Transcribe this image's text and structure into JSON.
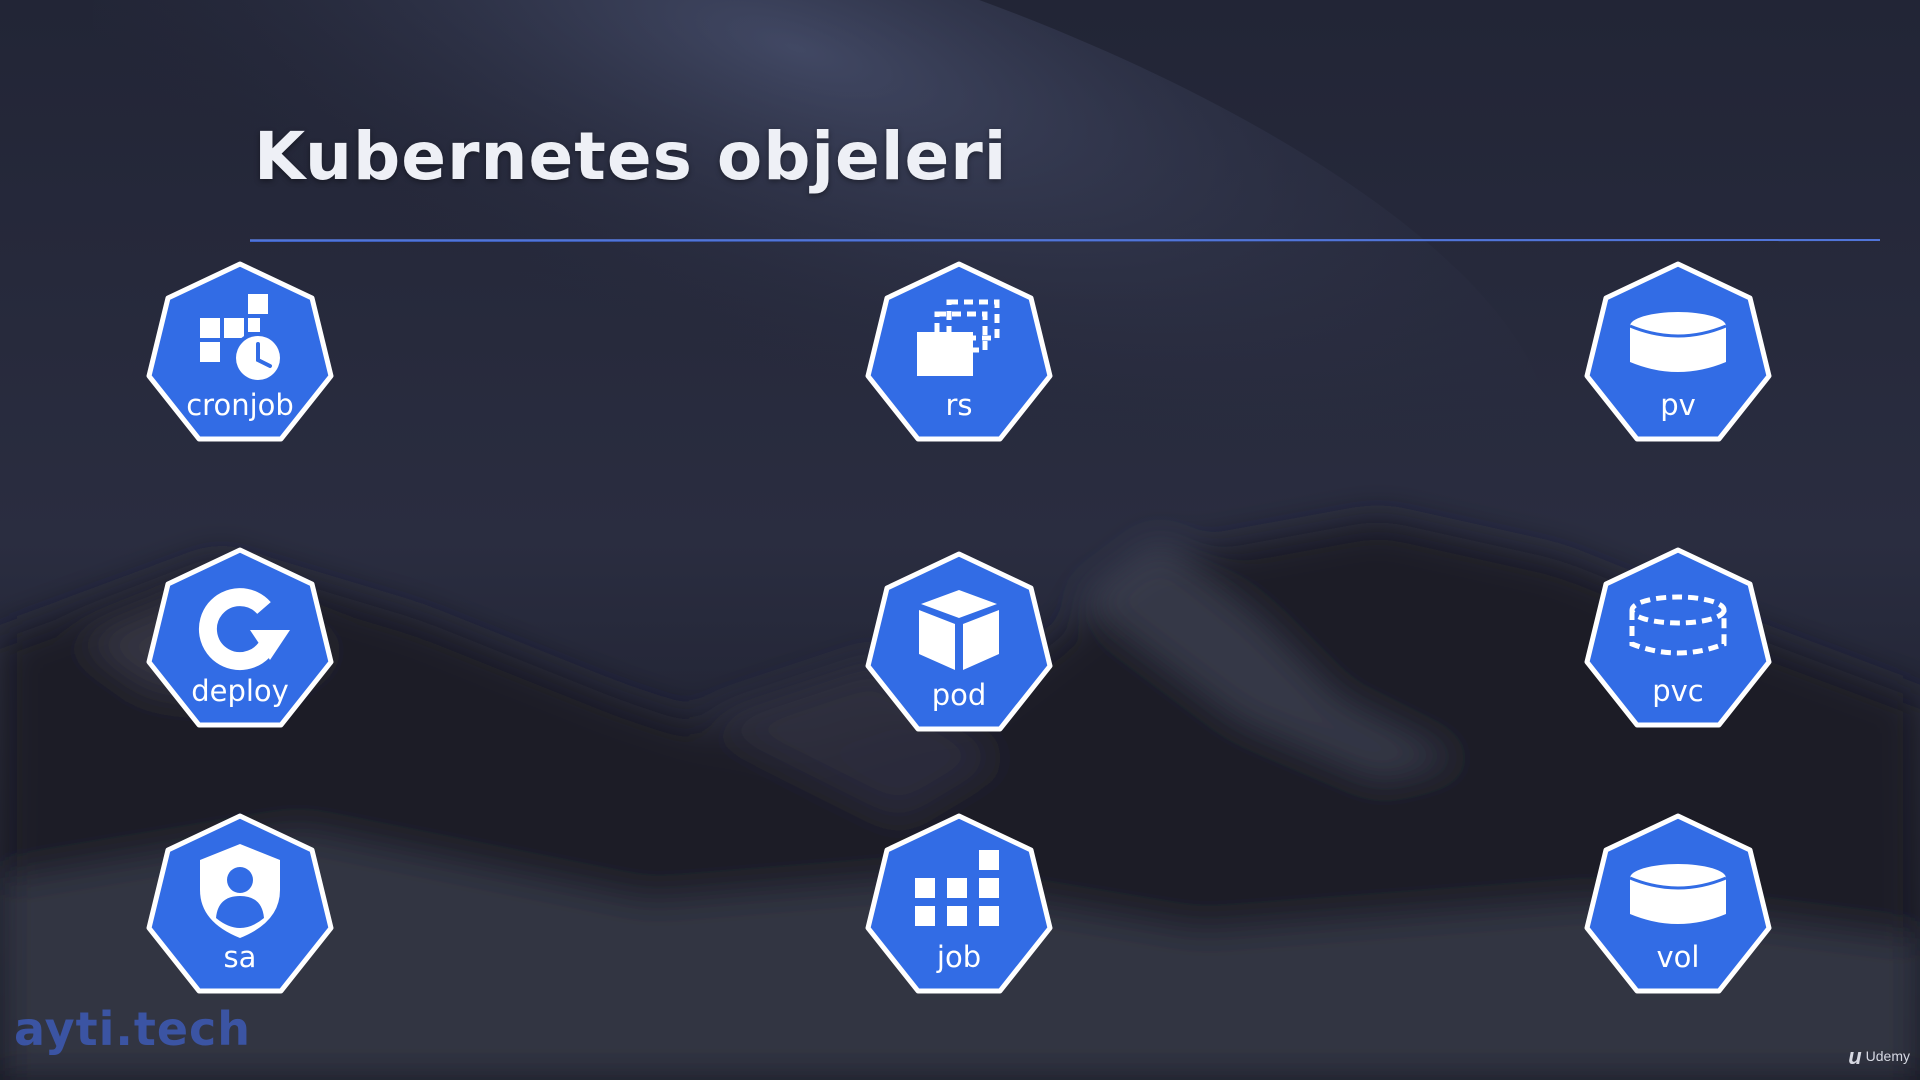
{
  "slide": {
    "title": "Kubernetes objeleri",
    "brand": "ayti.tech",
    "player_brand": "Udemy",
    "accent_color": "#326ce5"
  },
  "objects": [
    {
      "label": "cronjob",
      "icon": "cronjob-icon"
    },
    {
      "label": "rs",
      "icon": "replicaset-icon"
    },
    {
      "label": "pv",
      "icon": "persistent-volume-icon"
    },
    {
      "label": "deploy",
      "icon": "deployment-icon"
    },
    {
      "label": "pod",
      "icon": "pod-icon"
    },
    {
      "label": "pvc",
      "icon": "persistent-volume-claim-icon"
    },
    {
      "label": "sa",
      "icon": "service-account-icon"
    },
    {
      "label": "job",
      "icon": "job-icon"
    },
    {
      "label": "vol",
      "icon": "volume-icon"
    }
  ]
}
